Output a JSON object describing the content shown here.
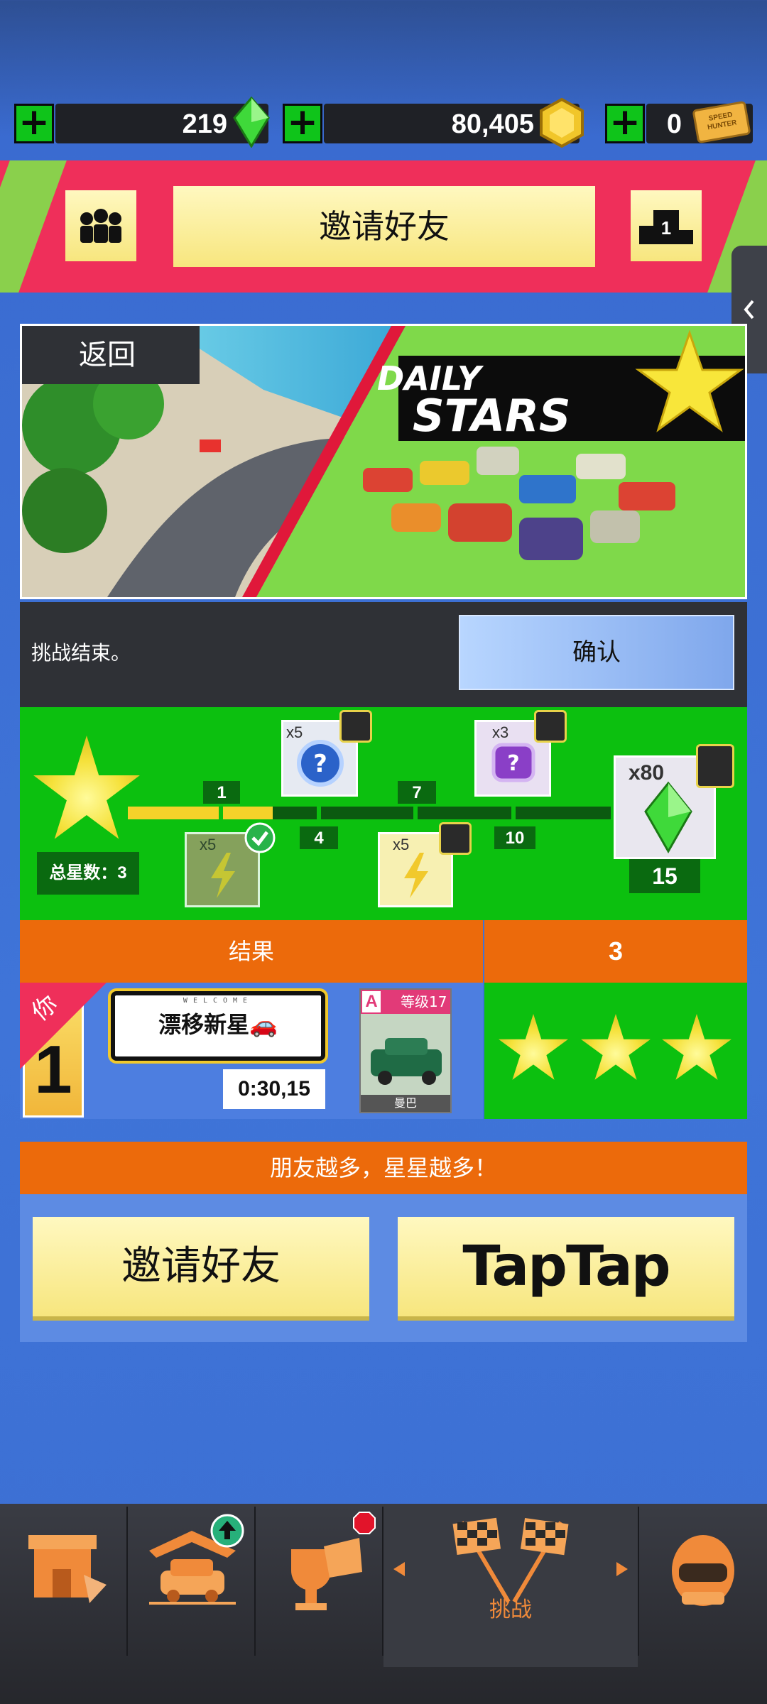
{
  "currency": {
    "gems": "219",
    "coins": "80,405",
    "tickets": "0",
    "plus_label": "+",
    "ticket_logo_text": "SPEED HUNTER"
  },
  "header": {
    "invite_label": "邀请好友",
    "rank_number": "1"
  },
  "banner": {
    "back_label": "返回",
    "title_line1": "DAILY",
    "title_line2": "STARS"
  },
  "challenge": {
    "status_text": "挑战结束。",
    "confirm_label": "确认"
  },
  "progress": {
    "total_stars_label": "总星数：3",
    "milestones": [
      "1",
      "4",
      "7",
      "10",
      "15"
    ],
    "rewards": [
      {
        "qty": "x5",
        "type": "mystery-blue"
      },
      {
        "qty": "x3",
        "type": "mystery-purple"
      },
      {
        "qty": "x80",
        "type": "gem"
      },
      {
        "qty": "x5",
        "type": "energy-claimed"
      },
      {
        "qty": "x5",
        "type": "energy"
      }
    ],
    "filled_fraction": 0.3
  },
  "results": {
    "header_label": "结果",
    "header_value": "3",
    "you_label": "你",
    "rank": "1",
    "plate_top": "WELCOME",
    "plate_text": "漂移新星🚗",
    "time": "0:30,15",
    "car_class": "A",
    "car_level": "等级17",
    "car_name": "曼巴",
    "stars": 3
  },
  "friends": {
    "banner_text": "朋友越多，星星越多！",
    "invite_label": "邀请好友",
    "taptap_label": "TapTap"
  },
  "nav": {
    "items": [
      {
        "name": "shop",
        "label": ""
      },
      {
        "name": "garage",
        "label": ""
      },
      {
        "name": "events",
        "label": ""
      },
      {
        "name": "challenge",
        "label": "挑战"
      },
      {
        "name": "profile",
        "label": ""
      }
    ]
  },
  "colors": {
    "accent_pink": "#ef2f5a",
    "panel_green": "#0cc00f",
    "orange": "#ec6a0b",
    "button_yellow": "#f7e67e",
    "confirm_blue": "#9ec2f5"
  }
}
